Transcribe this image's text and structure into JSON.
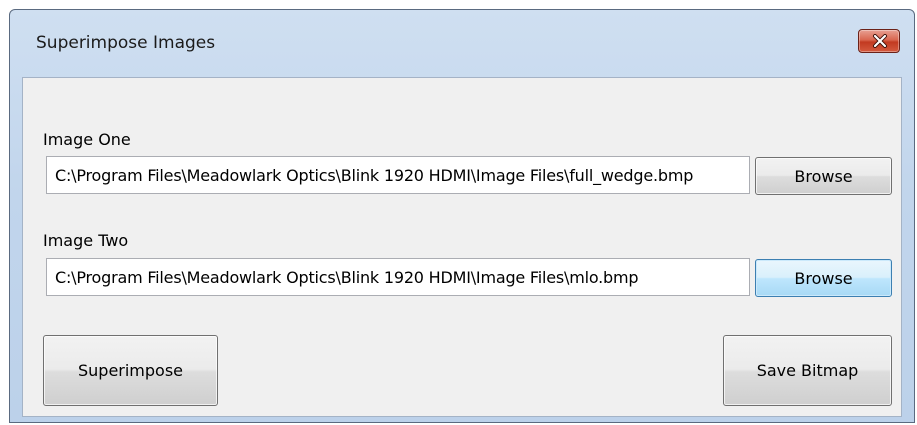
{
  "window": {
    "title": "Superimpose Images",
    "close_label": "close"
  },
  "image_one": {
    "label": "Image One",
    "path": "C:\\Program Files\\Meadowlark Optics\\Blink 1920 HDMI\\Image Files\\full_wedge.bmp",
    "browse_label": "Browse"
  },
  "image_two": {
    "label": "Image Two",
    "path": "C:\\Program Files\\Meadowlark Optics\\Blink 1920 HDMI\\Image Files\\mlo.bmp",
    "browse_label": "Browse"
  },
  "actions": {
    "superimpose_label": "Superimpose",
    "save_bitmap_label": "Save Bitmap"
  },
  "colors": {
    "titlebar": "#c4d8ee",
    "client": "#f0f0f0",
    "close_button": "#c7442a",
    "focus_border": "#3c7fb1"
  },
  "icons": {
    "close": "close-x-icon"
  }
}
